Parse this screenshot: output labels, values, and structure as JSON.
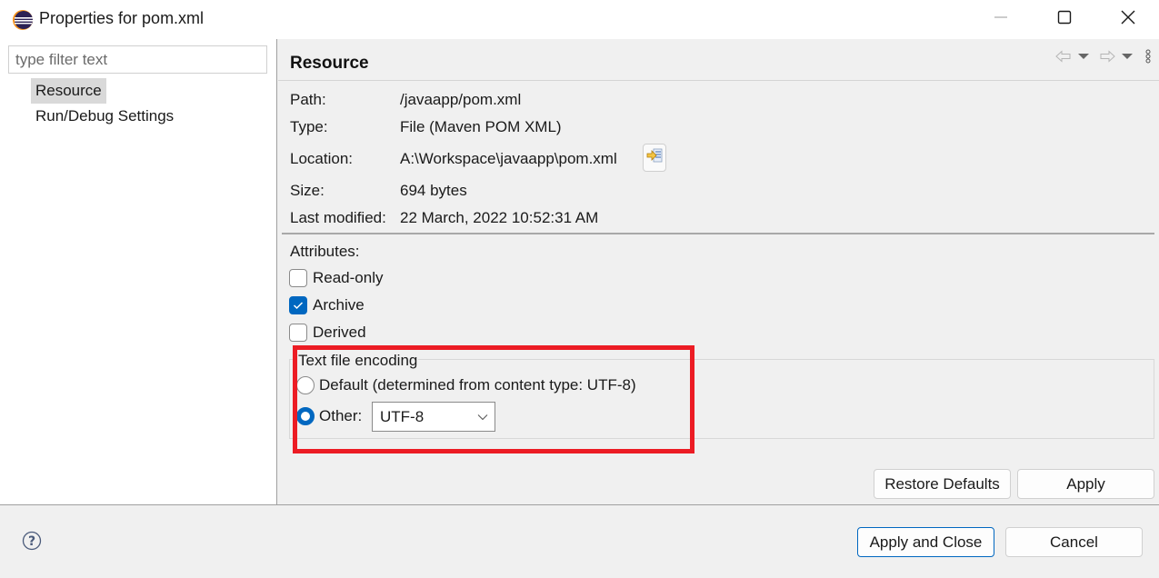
{
  "window": {
    "title": "Properties for pom.xml",
    "icon": "eclipse-icon",
    "controls": {
      "minimize": "minimize-icon",
      "maximize": "maximize-icon",
      "close": "close-icon"
    }
  },
  "sidebar": {
    "filter_placeholder": "type filter text",
    "filter_value": "",
    "items": [
      {
        "label": "Resource",
        "selected": true
      },
      {
        "label": "Run/Debug Settings",
        "selected": false
      }
    ]
  },
  "page": {
    "title": "Resource",
    "nav": {
      "back": "back-arrow-icon",
      "back_menu": "dropdown-icon",
      "forward": "forward-arrow-icon",
      "forward_menu": "dropdown-icon",
      "more": "more-vertical-icon"
    },
    "info": [
      {
        "label": "Path:",
        "value": "/javaapp/pom.xml"
      },
      {
        "label": "Type:",
        "value": "File  (Maven POM XML)"
      },
      {
        "label": "Location:",
        "value": "A:\\Workspace\\javaapp\\pom.xml"
      },
      {
        "label": "Size:",
        "value": "694  bytes"
      },
      {
        "label": "Last modified:",
        "value": "22 March, 2022 10:52:31 AM"
      }
    ],
    "show_in_system_explorer_icon": "open-in-explorer-icon",
    "attributes": {
      "label": "Attributes:",
      "items": [
        {
          "label": "Read-only",
          "checked": false
        },
        {
          "label": "Archive",
          "checked": true
        },
        {
          "label": "Derived",
          "checked": false
        }
      ]
    },
    "encoding": {
      "legend": "Text file encoding",
      "default_option": "Default (determined from content type: UTF-8)",
      "other_option": "Other:",
      "selected": "other",
      "other_value": "UTF-8"
    },
    "buttons": {
      "restore_defaults": "Restore Defaults",
      "apply": "Apply"
    }
  },
  "footer": {
    "help_icon": "help-icon",
    "apply_and_close": "Apply and Close",
    "cancel": "Cancel"
  },
  "annotation": {
    "highlight_color": "#ec1c24"
  },
  "colors": {
    "accent": "#0067c0"
  }
}
